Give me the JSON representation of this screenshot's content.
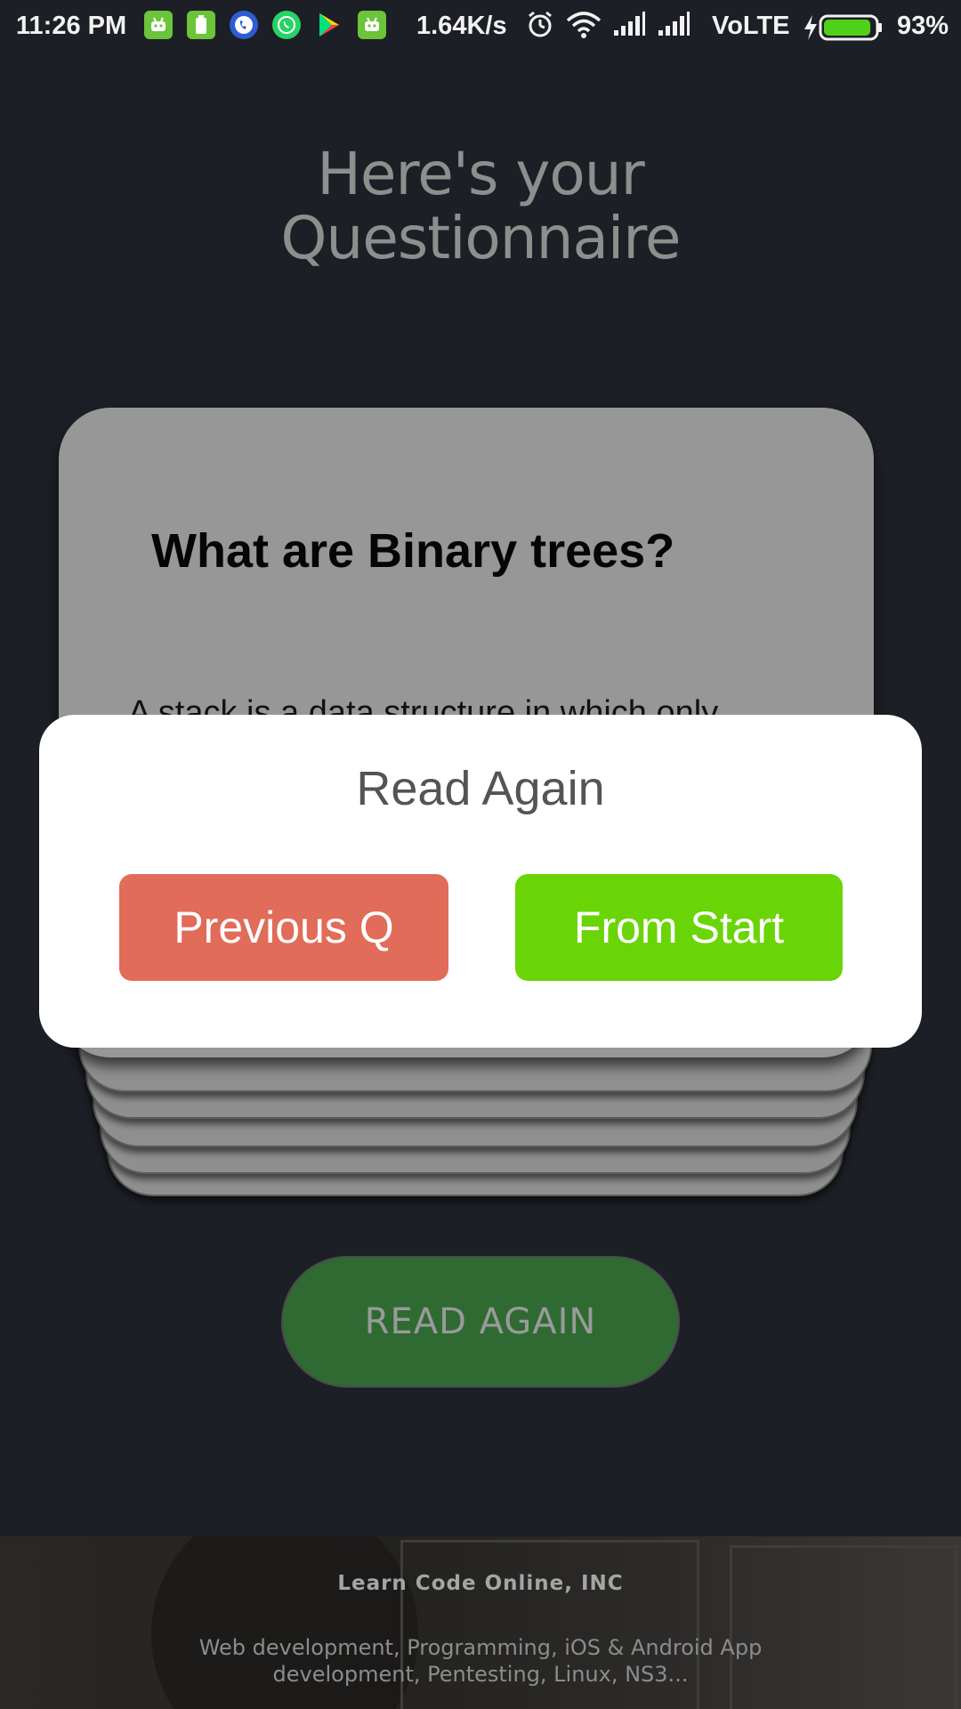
{
  "status_bar": {
    "time": "11:26 PM",
    "network_speed": "1.64K/s",
    "network_type": "VoLTE",
    "battery_percent": "93%",
    "battery_level": 0.93,
    "app_icons": [
      "android-icon",
      "battery-saver-icon",
      "truecaller-icon",
      "whatsapp-icon",
      "play-store-icon",
      "android-icon"
    ],
    "system_icons": [
      "alarm-icon",
      "wifi-icon",
      "signal-icon",
      "signal-icon",
      "charging-icon"
    ]
  },
  "title": {
    "line1": "Here's your",
    "line2": "Questionnaire"
  },
  "card": {
    "question": "What are Binary trees?",
    "answer_preview": "A stack is a data structure in which only"
  },
  "dialog": {
    "title": "Read Again",
    "previous_label": "Previous Q",
    "start_label": "From Start"
  },
  "read_again_button": {
    "label": "READ AGAIN"
  },
  "footer": {
    "company": "Learn Code Online, INC",
    "description": "Web development, Programming, iOS & Android App development, Pentesting, Linux, NS3..."
  },
  "colors": {
    "background": "#1c1f25",
    "card": "#979797",
    "previous_button": "#e06c59",
    "start_button": "#6ad506",
    "read_again_button": "#2f6a32"
  }
}
